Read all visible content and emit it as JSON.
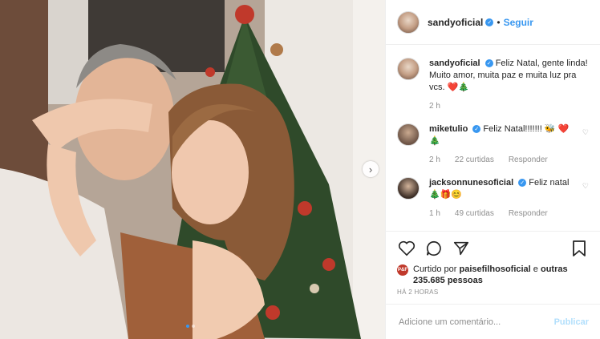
{
  "post": {
    "username": "sandyoficial",
    "follow_label": "Seguir",
    "separator": "•",
    "verified_mark": "✓",
    "next_arrow": "›"
  },
  "comments": [
    {
      "username": "sandyoficial",
      "text": "Feliz Natal, gente linda! Muito amor, muita paz e muita luz pra vcs. ❤️🎄",
      "time": "2 h",
      "likes": "",
      "reply": ""
    },
    {
      "username": "miketulio",
      "text": "Feliz Natal!!!!!!! 🐝 ❤️🎄",
      "time": "2 h",
      "likes": "22 curtidas",
      "reply": "Responder"
    },
    {
      "username": "jacksonnunesoficial",
      "text": "Feliz natal 🎄🎁😊",
      "time": "1 h",
      "likes": "49 curtidas",
      "reply": "Responder"
    }
  ],
  "likes": {
    "prefix": "Curtido por",
    "liker": "paisefilhosoficial",
    "middle": "e",
    "others": "outras 235.685 pessoas",
    "avatar_text": "P&F"
  },
  "timestamp": "HÁ 2 HORAS",
  "add_comment": {
    "placeholder": "Adicione um comentário...",
    "post_label": "Publicar"
  },
  "colors": {
    "accent": "#3897f0",
    "post_disabled": "#b2dffc",
    "muted": "#8e8e8e"
  }
}
